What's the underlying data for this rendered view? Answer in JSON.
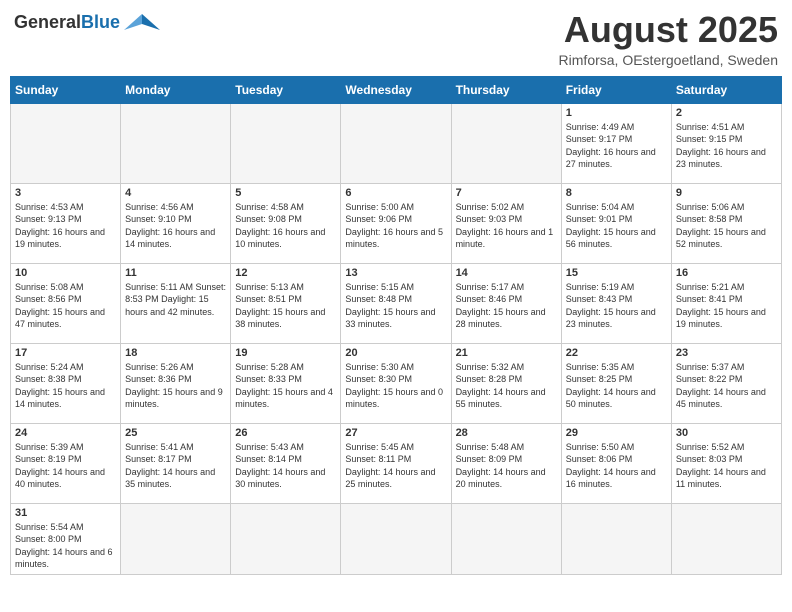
{
  "header": {
    "logo_general": "General",
    "logo_blue": "Blue",
    "month_title": "August 2025",
    "subtitle": "Rimforsa, OEstergoetland, Sweden"
  },
  "weekdays": [
    "Sunday",
    "Monday",
    "Tuesday",
    "Wednesday",
    "Thursday",
    "Friday",
    "Saturday"
  ],
  "weeks": [
    [
      {
        "day": "",
        "info": ""
      },
      {
        "day": "",
        "info": ""
      },
      {
        "day": "",
        "info": ""
      },
      {
        "day": "",
        "info": ""
      },
      {
        "day": "",
        "info": ""
      },
      {
        "day": "1",
        "info": "Sunrise: 4:49 AM\nSunset: 9:17 PM\nDaylight: 16 hours\nand 27 minutes."
      },
      {
        "day": "2",
        "info": "Sunrise: 4:51 AM\nSunset: 9:15 PM\nDaylight: 16 hours\nand 23 minutes."
      }
    ],
    [
      {
        "day": "3",
        "info": "Sunrise: 4:53 AM\nSunset: 9:13 PM\nDaylight: 16 hours\nand 19 minutes."
      },
      {
        "day": "4",
        "info": "Sunrise: 4:56 AM\nSunset: 9:10 PM\nDaylight: 16 hours\nand 14 minutes."
      },
      {
        "day": "5",
        "info": "Sunrise: 4:58 AM\nSunset: 9:08 PM\nDaylight: 16 hours\nand 10 minutes."
      },
      {
        "day": "6",
        "info": "Sunrise: 5:00 AM\nSunset: 9:06 PM\nDaylight: 16 hours\nand 5 minutes."
      },
      {
        "day": "7",
        "info": "Sunrise: 5:02 AM\nSunset: 9:03 PM\nDaylight: 16 hours\nand 1 minute."
      },
      {
        "day": "8",
        "info": "Sunrise: 5:04 AM\nSunset: 9:01 PM\nDaylight: 15 hours\nand 56 minutes."
      },
      {
        "day": "9",
        "info": "Sunrise: 5:06 AM\nSunset: 8:58 PM\nDaylight: 15 hours\nand 52 minutes."
      }
    ],
    [
      {
        "day": "10",
        "info": "Sunrise: 5:08 AM\nSunset: 8:56 PM\nDaylight: 15 hours\nand 47 minutes."
      },
      {
        "day": "11",
        "info": "Sunrise: 5:11 AM\nSunset: 8:53 PM\nDaylight: 15 hours\nand 42 minutes."
      },
      {
        "day": "12",
        "info": "Sunrise: 5:13 AM\nSunset: 8:51 PM\nDaylight: 15 hours\nand 38 minutes."
      },
      {
        "day": "13",
        "info": "Sunrise: 5:15 AM\nSunset: 8:48 PM\nDaylight: 15 hours\nand 33 minutes."
      },
      {
        "day": "14",
        "info": "Sunrise: 5:17 AM\nSunset: 8:46 PM\nDaylight: 15 hours\nand 28 minutes."
      },
      {
        "day": "15",
        "info": "Sunrise: 5:19 AM\nSunset: 8:43 PM\nDaylight: 15 hours\nand 23 minutes."
      },
      {
        "day": "16",
        "info": "Sunrise: 5:21 AM\nSunset: 8:41 PM\nDaylight: 15 hours\nand 19 minutes."
      }
    ],
    [
      {
        "day": "17",
        "info": "Sunrise: 5:24 AM\nSunset: 8:38 PM\nDaylight: 15 hours\nand 14 minutes."
      },
      {
        "day": "18",
        "info": "Sunrise: 5:26 AM\nSunset: 8:36 PM\nDaylight: 15 hours\nand 9 minutes."
      },
      {
        "day": "19",
        "info": "Sunrise: 5:28 AM\nSunset: 8:33 PM\nDaylight: 15 hours\nand 4 minutes."
      },
      {
        "day": "20",
        "info": "Sunrise: 5:30 AM\nSunset: 8:30 PM\nDaylight: 15 hours\nand 0 minutes."
      },
      {
        "day": "21",
        "info": "Sunrise: 5:32 AM\nSunset: 8:28 PM\nDaylight: 14 hours\nand 55 minutes."
      },
      {
        "day": "22",
        "info": "Sunrise: 5:35 AM\nSunset: 8:25 PM\nDaylight: 14 hours\nand 50 minutes."
      },
      {
        "day": "23",
        "info": "Sunrise: 5:37 AM\nSunset: 8:22 PM\nDaylight: 14 hours\nand 45 minutes."
      }
    ],
    [
      {
        "day": "24",
        "info": "Sunrise: 5:39 AM\nSunset: 8:19 PM\nDaylight: 14 hours\nand 40 minutes."
      },
      {
        "day": "25",
        "info": "Sunrise: 5:41 AM\nSunset: 8:17 PM\nDaylight: 14 hours\nand 35 minutes."
      },
      {
        "day": "26",
        "info": "Sunrise: 5:43 AM\nSunset: 8:14 PM\nDaylight: 14 hours\nand 30 minutes."
      },
      {
        "day": "27",
        "info": "Sunrise: 5:45 AM\nSunset: 8:11 PM\nDaylight: 14 hours\nand 25 minutes."
      },
      {
        "day": "28",
        "info": "Sunrise: 5:48 AM\nSunset: 8:09 PM\nDaylight: 14 hours\nand 20 minutes."
      },
      {
        "day": "29",
        "info": "Sunrise: 5:50 AM\nSunset: 8:06 PM\nDaylight: 14 hours\nand 16 minutes."
      },
      {
        "day": "30",
        "info": "Sunrise: 5:52 AM\nSunset: 8:03 PM\nDaylight: 14 hours\nand 11 minutes."
      }
    ],
    [
      {
        "day": "31",
        "info": "Sunrise: 5:54 AM\nSunset: 8:00 PM\nDaylight: 14 hours\nand 6 minutes."
      },
      {
        "day": "",
        "info": ""
      },
      {
        "day": "",
        "info": ""
      },
      {
        "day": "",
        "info": ""
      },
      {
        "day": "",
        "info": ""
      },
      {
        "day": "",
        "info": ""
      },
      {
        "day": "",
        "info": ""
      }
    ]
  ]
}
